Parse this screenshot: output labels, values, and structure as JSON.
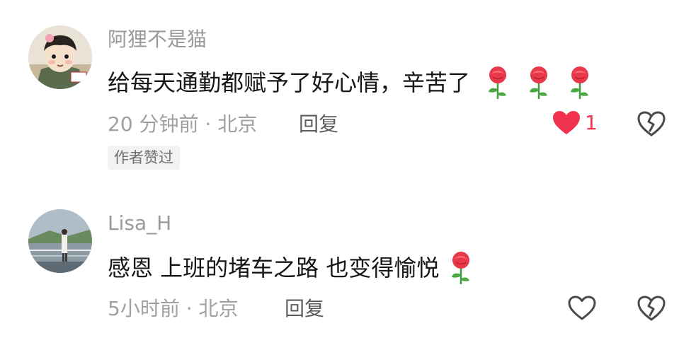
{
  "comments": [
    {
      "username": "阿狸不是猫",
      "text": "给每天通勤都赋予了好心情，辛苦了",
      "emojis": [
        "rose",
        "rose",
        "rose"
      ],
      "time": "20 分钟前 · 北京",
      "reply_label": "回复",
      "liked": true,
      "like_count": "1",
      "badge": "作者赞过",
      "like_color": "#f2334f"
    },
    {
      "username": "Lisa_H",
      "text": "感恩 上班的堵车之路 也变得愉悦",
      "emojis": [
        "rose"
      ],
      "time": "5小时前 · 北京",
      "reply_label": "回复",
      "liked": false
    }
  ],
  "icons": {
    "like": "heart-icon",
    "dislike": "broken-heart-icon",
    "emoji": "rose-emoji"
  }
}
